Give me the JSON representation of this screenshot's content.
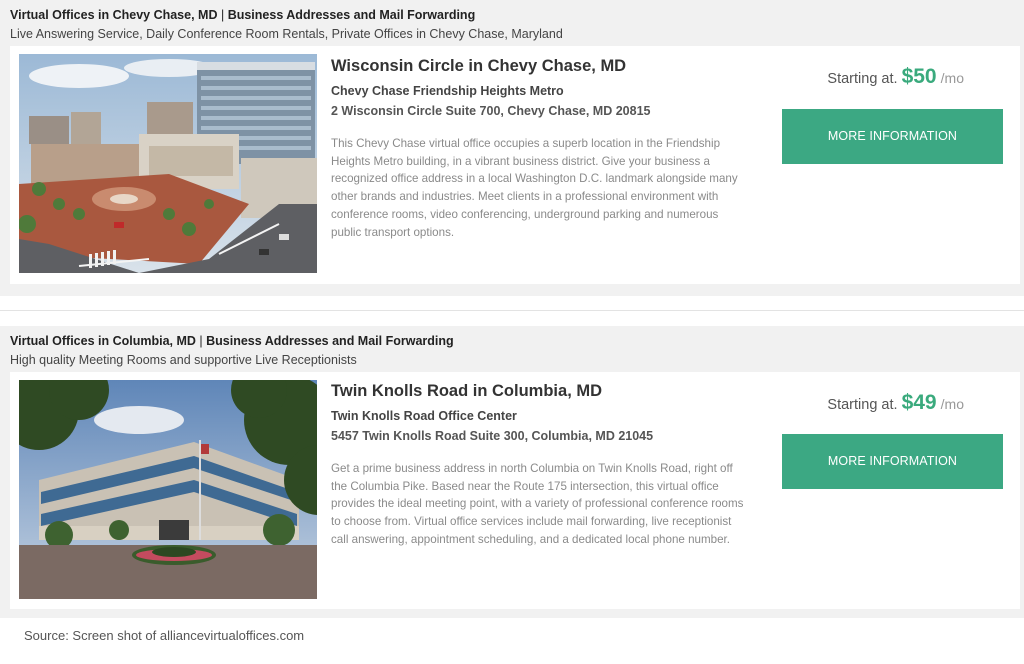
{
  "listings": [
    {
      "heading": "Virtual Offices in Chevy Chase, MD",
      "heading_sep": " | ",
      "heading_tail": "Business Addresses and Mail Forwarding",
      "subheading": "Live Answering Service, Daily Conference Room Rentals, Private Offices in Chevy Chase, Maryland",
      "title": "Wisconsin Circle in Chevy Chase, MD",
      "building": "Chevy Chase Friendship Heights Metro",
      "address": "2 Wisconsin Circle Suite 700, Chevy Chase, MD 20815",
      "description": "This Chevy Chase virtual office occupies a superb location in the Friendship Heights Metro building, in a vibrant business district. Give your business a recognized office address in a local Washington D.C. landmark alongside many other brands and industries. Meet clients in a professional environment with conference rooms, video conferencing, underground parking and numerous public transport options.",
      "price_prefix": "Starting at.",
      "price": "$50",
      "price_unit": "/mo",
      "button_label": "MORE INFORMATION"
    },
    {
      "heading": "Virtual Offices in Columbia, MD",
      "heading_sep": " | ",
      "heading_tail": "Business Addresses and Mail Forwarding",
      "subheading": "High quality Meeting Rooms and supportive Live Receptionists",
      "title": "Twin Knolls Road in Columbia, MD",
      "building": "Twin Knolls Road Office Center",
      "address": "5457 Twin Knolls Road Suite 300, Columbia, MD 21045",
      "description": "Get a prime business address in north Columbia on Twin Knolls Road, right off the Columbia Pike. Based near the Route 175 intersection, this virtual office provides the ideal meeting point, with a variety of professional conference rooms to choose from. Virtual office services include mail forwarding, live receptionist call answering, appointment scheduling, and a dedicated local phone number.",
      "price_prefix": "Starting at.",
      "price": "$49",
      "price_unit": "/mo",
      "button_label": "MORE INFORMATION"
    }
  ],
  "source_caption": "Source: Screen shot of alliancevirtualoffices.com",
  "colors": {
    "accent": "#3aaa7d",
    "button": "#3ca883",
    "band_background": "#f1f1f1"
  }
}
